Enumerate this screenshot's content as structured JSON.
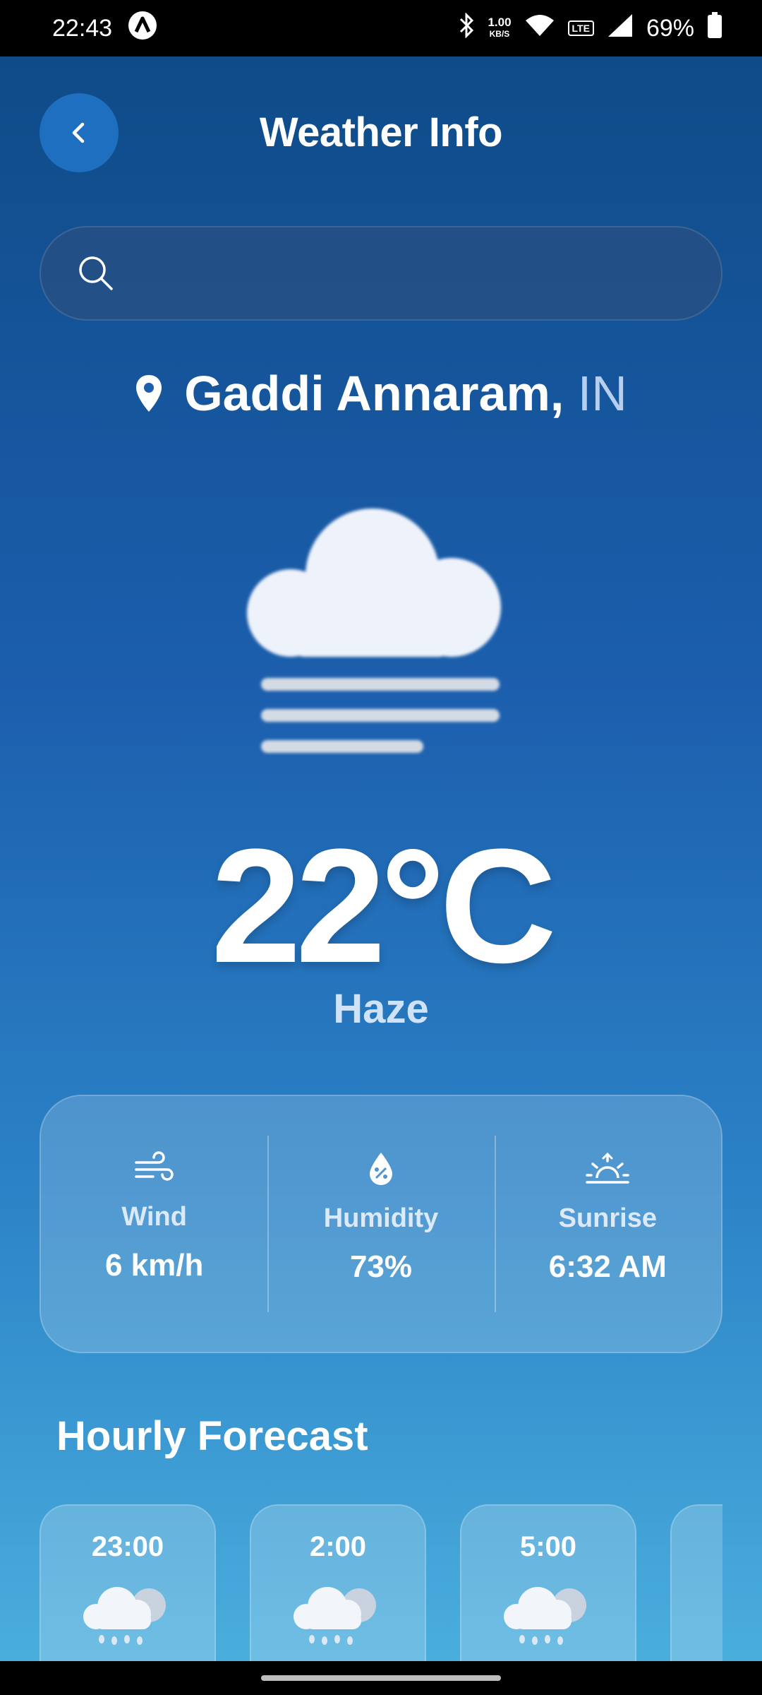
{
  "status_bar": {
    "time": "22:43",
    "speed_value": "1.00",
    "speed_unit": "KB/S",
    "lte": "LTE",
    "battery": "69%",
    "icons": [
      "app-icon",
      "bluetooth-icon",
      "wifi-icon",
      "lte-icon",
      "signal-icon",
      "battery-icon"
    ]
  },
  "header": {
    "title": "Weather Info",
    "back_icon": "chevron-left-icon"
  },
  "search": {
    "placeholder": "",
    "value": "",
    "icon": "search-icon"
  },
  "location": {
    "city": "Gaddi Annaram,",
    "country": "IN",
    "icon": "location-pin-icon"
  },
  "current": {
    "icon": "haze-cloud-icon",
    "temperature": "22°C",
    "condition": "Haze"
  },
  "stats": [
    {
      "icon": "wind-icon",
      "label": "Wind",
      "value": "6 km/h"
    },
    {
      "icon": "humidity-icon",
      "label": "Humidity",
      "value": "73%"
    },
    {
      "icon": "sunrise-icon",
      "label": "Sunrise",
      "value": "6:32 AM"
    }
  ],
  "hourly": {
    "title": "Hourly Forecast",
    "items": [
      {
        "time": "23:00",
        "icon": "rain-cloud-icon"
      },
      {
        "time": "2:00",
        "icon": "rain-cloud-icon"
      },
      {
        "time": "5:00",
        "icon": "rain-cloud-icon"
      },
      {
        "time": "",
        "icon": "rain-cloud-icon"
      }
    ]
  },
  "colors": {
    "background_top": "#0f4b88",
    "background_bottom": "#4aaedd",
    "back_button": "#1f6fc1",
    "text": "#ffffff"
  }
}
